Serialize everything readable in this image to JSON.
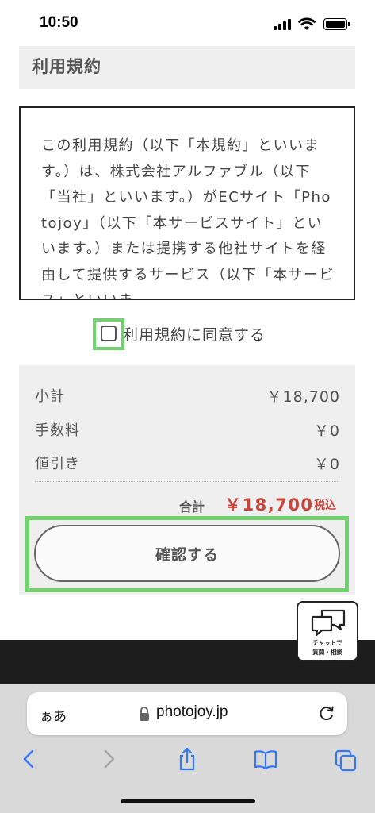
{
  "status_bar": {
    "time": "10:50"
  },
  "terms": {
    "heading": "利用規約",
    "text": "この利用規約（以下「本規約」といいます。）は、株式会社アルファブル（以下「当社」といいます。）がECサイト「Photojoy」（以下「本サービスサイト」といいます。）または提携する他社サイトを経由して提供するサービス（以下「本サービス」といいま"
  },
  "agreement": {
    "label": "利用規約に同意する",
    "checked": false
  },
  "summary": {
    "rows": [
      {
        "label": "小計",
        "value": "￥18,700"
      },
      {
        "label": "手数料",
        "value": "￥0"
      },
      {
        "label": "値引き",
        "value": "￥0"
      }
    ],
    "total_label": "合計",
    "total_value": "￥18,700",
    "total_tax": "税込",
    "confirm_label": "確認する"
  },
  "chat_widget": {
    "line1": "チャットで",
    "line2": "質問・相談"
  },
  "browser": {
    "aa_label": "ぁあ",
    "url": "photojoy.jp"
  },
  "colors": {
    "accent_price": "#c8453a",
    "highlight": "#6fd26a",
    "safari_blue": "#3478f6"
  }
}
